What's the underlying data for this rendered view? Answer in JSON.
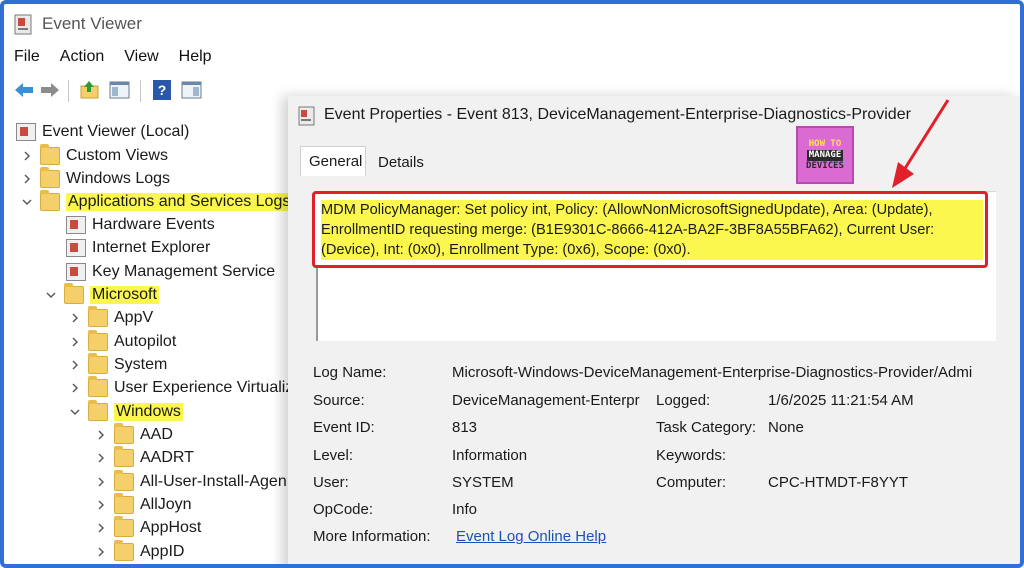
{
  "window": {
    "title": "Event Viewer",
    "icon": "event-viewer-icon"
  },
  "menu": [
    "File",
    "Action",
    "View",
    "Help"
  ],
  "toolbar": [
    "back-arrow-icon",
    "forward-arrow-icon",
    "up-folder-icon",
    "show-pane-icon",
    "help-icon",
    "action-pane-icon"
  ],
  "tree": {
    "root": "Event Viewer (Local)",
    "custom_views": "Custom Views",
    "windows_logs": "Windows Logs",
    "apps_services": "Applications and Services Logs",
    "hardware_events": "Hardware Events",
    "internet_explorer": "Internet Explorer",
    "key_management": "Key Management Service",
    "microsoft": "Microsoft",
    "appv": "AppV",
    "autopilot": "Autopilot",
    "system": "System",
    "uev": "User Experience Virtualiza",
    "windows": "Windows",
    "aad": "AAD",
    "aadrt": "AADRT",
    "all_user_install": "All-User-Install-Agen",
    "alljoyn": "AllJoyn",
    "apphost": "AppHost",
    "appid": "AppID"
  },
  "dialog": {
    "title": "Event Properties - Event 813, DeviceManagement-Enterprise-Diagnostics-Provider",
    "tabs": [
      "General",
      "Details"
    ],
    "description": "MDM PolicyManager: Set policy int, Policy: (AllowNonMicrosoftSignedUpdate), Area: (Update), EnrollmentID requesting merge: (B1E9301C-8666-412A-BA2F-3BF8A55BFA62), Current User: (Device), Int: (0x0), Enrollment Type: (0x6), Scope: (0x0).",
    "fields": {
      "log_name_label": "Log Name:",
      "log_name": "Microsoft-Windows-DeviceManagement-Enterprise-Diagnostics-Provider/Admi",
      "source_label": "Source:",
      "source": "DeviceManagement-Enterpr",
      "logged_label": "Logged:",
      "logged": "1/6/2025 11:21:54 AM",
      "event_id_label": "Event ID:",
      "event_id": "813",
      "task_category_label": "Task Category:",
      "task_category": "None",
      "level_label": "Level:",
      "level": "Information",
      "keywords_label": "Keywords:",
      "keywords": "",
      "user_label": "User:",
      "user": "SYSTEM",
      "computer_label": "Computer:",
      "computer": "CPC-HTMDT-F8YYT",
      "opcode_label": "OpCode:",
      "opcode": "Info",
      "more_info_label": "More Information:",
      "more_info_link": "Event Log Online Help"
    }
  },
  "watermark": {
    "line1": "HOW TO",
    "line2": "MANAGE",
    "line3": "DEVICES"
  },
  "colors": {
    "highlight": "#fbf74e",
    "callout": "#e0212b",
    "frame": "#2f6fd6",
    "link": "#1d4fb8"
  }
}
